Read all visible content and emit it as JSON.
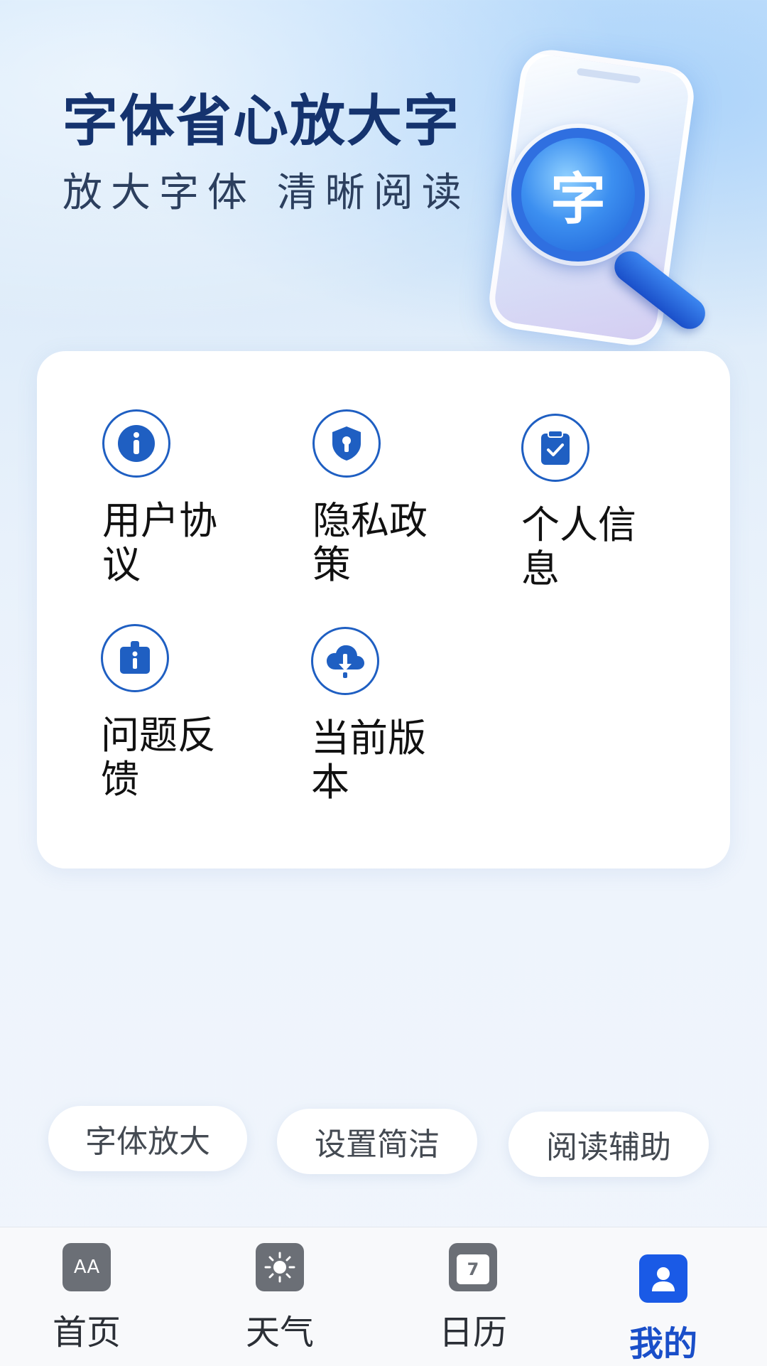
{
  "header": {
    "title": "字体省心放大字",
    "subtitle": "放大字体  清晰阅读",
    "illustration_char": "字"
  },
  "menu": {
    "items": [
      {
        "label": "用户协议",
        "icon": "info-icon"
      },
      {
        "label": "隐私政策",
        "icon": "shield-lock-icon"
      },
      {
        "label": "个人信息",
        "icon": "clipboard-check-icon"
      },
      {
        "label": "问题反馈",
        "icon": "feedback-info-icon"
      },
      {
        "label": "当前版本",
        "icon": "cloud-download-icon"
      }
    ]
  },
  "chips": [
    "字体放大",
    "设置简洁",
    "阅读辅助"
  ],
  "nav": {
    "items": [
      {
        "label": "首页",
        "icon": "font-size-icon",
        "active": false
      },
      {
        "label": "天气",
        "icon": "sun-icon",
        "active": false
      },
      {
        "label": "日历",
        "icon": "calendar-icon",
        "active": false,
        "icon_text": "7"
      },
      {
        "label": "我的",
        "icon": "user-icon",
        "active": true
      }
    ],
    "home_icon_text": "AA"
  },
  "colors": {
    "accent": "#1a5ae6",
    "title": "#15336e",
    "icon_stroke": "#1f5fc2",
    "nav_inactive_icon": "#6b6f76"
  }
}
